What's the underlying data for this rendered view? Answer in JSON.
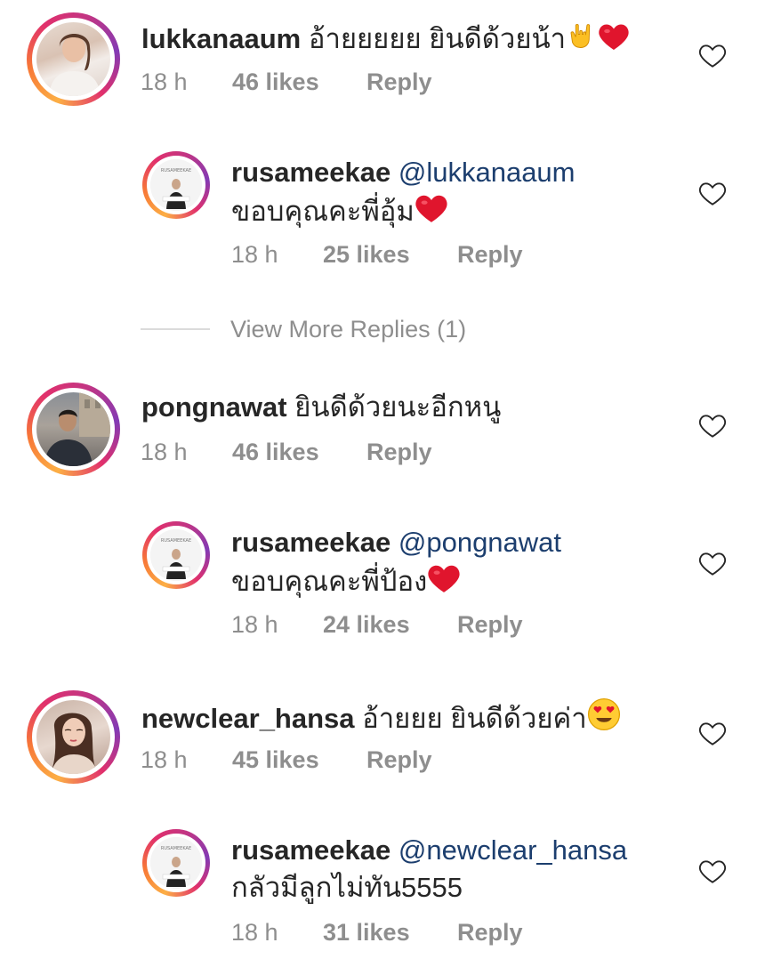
{
  "comments": [
    {
      "username": "lukkanaaum",
      "text": "อ้ายยยยย ยินดีด้วยน้า",
      "emojis": [
        "love-you-hand-emoji",
        "heart-emoji"
      ],
      "time": "18 h",
      "likes": "46 likes",
      "reply_label": "Reply",
      "reply": {
        "username": "rusameekae",
        "mention": "@lukkanaaum",
        "text": "ขอบคุณคะพี่อุ้ม",
        "emoji": "heart-emoji",
        "time": "18 h",
        "likes": "25 likes",
        "reply_label": "Reply"
      },
      "view_more": "View More Replies (1)"
    },
    {
      "username": "pongnawat",
      "text": "ยินดีด้วยนะอีกหนู",
      "time": "18 h",
      "likes": "46 likes",
      "reply_label": "Reply",
      "reply": {
        "username": "rusameekae",
        "mention": "@pongnawat",
        "text": "ขอบคุณคะพี่ป้อง",
        "emoji": "heart-emoji",
        "time": "18 h",
        "likes": "24 likes",
        "reply_label": "Reply"
      }
    },
    {
      "username": "newclear_hansa",
      "text": "อ้ายยย ยินดีด้วยค่า",
      "emojis": [
        "heart-eyes-emoji"
      ],
      "time": "18 h",
      "likes": "45 likes",
      "reply_label": "Reply",
      "reply": {
        "username": "rusameekae",
        "mention": "@newclear_hansa",
        "text": "กลัวมีลูกไม่ทัน5555",
        "time": "18 h",
        "likes": "31 likes",
        "reply_label": "Reply"
      }
    }
  ],
  "avatar_watermark": "RUSAMEEKAE",
  "colors": {
    "text": "#262626",
    "muted": "#8e8e8e",
    "mention": "#1c3e6e",
    "heart_emoji": "#e0152d"
  }
}
